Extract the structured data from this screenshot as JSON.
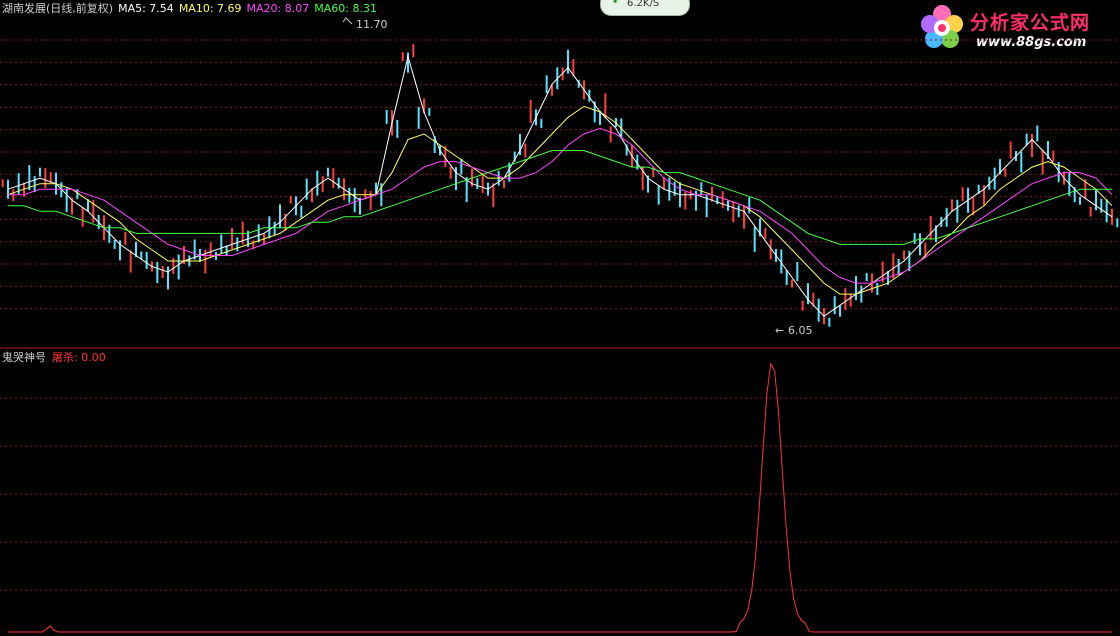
{
  "header": {
    "stock_title": "湖南发展(日线,前复权)",
    "ma_labels": [
      {
        "text": "MA5: 7.54",
        "color": "#ffffff"
      },
      {
        "text": "MA10: 7.69",
        "color": "#ffff66"
      },
      {
        "text": "MA20: 8.07",
        "color": "#ff44ff"
      },
      {
        "text": "MA60: 8.31",
        "color": "#44ff44"
      }
    ]
  },
  "speed_badge": {
    "text": "6.2K/S",
    "icon": "download-arrow-icon"
  },
  "logo": {
    "name": "分析家公式网",
    "url": "www.88gs.com",
    "icon": "flower-logo-icon"
  },
  "price_chart": {
    "high_label": "11.70",
    "low_label": "6.05"
  },
  "indicator": {
    "name": "鬼哭神号",
    "value_label": "屠杀: 0.00",
    "value_color": "#ff3333"
  },
  "chart_data": [
    {
      "type": "line",
      "title": "湖南发展(日线,前复权)",
      "yrange": [
        6.05,
        11.7
      ],
      "series": [
        {
          "name": "MA5",
          "color": "#ffffff",
          "values": [
            8.6,
            8.7,
            8.8,
            8.7,
            8.4,
            8.2,
            7.9,
            7.6,
            7.4,
            7.2,
            7.1,
            7.3,
            7.4,
            7.5,
            7.6,
            7.7,
            7.8,
            8.0,
            8.3,
            8.6,
            8.8,
            8.6,
            8.4,
            8.5,
            9.8,
            11.0,
            10.0,
            9.3,
            8.9,
            8.7,
            8.6,
            8.8,
            9.3,
            9.9,
            10.5,
            10.8,
            10.4,
            10.0,
            9.7,
            9.2,
            8.8,
            8.6,
            8.5,
            8.5,
            8.4,
            8.3,
            8.2,
            7.8,
            7.4,
            7.0,
            6.6,
            6.3,
            6.5,
            6.7,
            6.9,
            7.1,
            7.3,
            7.6,
            7.9,
            8.2,
            8.4,
            8.6,
            8.9,
            9.2,
            9.5,
            9.2,
            8.8,
            8.5,
            8.3,
            8.1
          ]
        },
        {
          "name": "MA10",
          "color": "#ffff66",
          "values": [
            8.5,
            8.6,
            8.7,
            8.7,
            8.6,
            8.4,
            8.2,
            8.0,
            7.7,
            7.5,
            7.3,
            7.3,
            7.3,
            7.4,
            7.5,
            7.6,
            7.7,
            7.8,
            8.0,
            8.2,
            8.4,
            8.5,
            8.5,
            8.5,
            8.9,
            9.5,
            9.6,
            9.4,
            9.2,
            9.0,
            8.8,
            8.8,
            9.0,
            9.3,
            9.6,
            9.9,
            10.1,
            10.0,
            9.8,
            9.5,
            9.2,
            8.9,
            8.7,
            8.6,
            8.5,
            8.4,
            8.3,
            8.1,
            7.8,
            7.5,
            7.2,
            6.9,
            6.7,
            6.7,
            6.8,
            6.9,
            7.1,
            7.3,
            7.6,
            7.8,
            8.1,
            8.3,
            8.6,
            8.8,
            9.0,
            9.1,
            9.0,
            8.8,
            8.6,
            8.3
          ]
        },
        {
          "name": "MA20",
          "color": "#ff44ff",
          "values": [
            8.5,
            8.5,
            8.6,
            8.6,
            8.6,
            8.5,
            8.4,
            8.2,
            8.0,
            7.8,
            7.6,
            7.5,
            7.4,
            7.4,
            7.4,
            7.5,
            7.6,
            7.7,
            7.8,
            8.0,
            8.2,
            8.3,
            8.4,
            8.5,
            8.6,
            8.8,
            9.0,
            9.1,
            9.1,
            9.0,
            8.9,
            8.8,
            8.8,
            8.9,
            9.1,
            9.4,
            9.6,
            9.7,
            9.6,
            9.4,
            9.1,
            8.8,
            8.6,
            8.5,
            8.5,
            8.4,
            8.3,
            8.2,
            8.0,
            7.8,
            7.5,
            7.2,
            7.0,
            6.9,
            6.9,
            7.0,
            7.1,
            7.3,
            7.5,
            7.7,
            7.9,
            8.1,
            8.3,
            8.5,
            8.7,
            8.8,
            8.9,
            8.9,
            8.8,
            8.5
          ]
        },
        {
          "name": "MA60",
          "color": "#44ff44",
          "values": [
            8.3,
            8.3,
            8.2,
            8.2,
            8.1,
            8.0,
            7.9,
            7.9,
            7.8,
            7.8,
            7.8,
            7.8,
            7.8,
            7.8,
            7.8,
            7.8,
            7.9,
            7.9,
            7.9,
            8.0,
            8.0,
            8.1,
            8.1,
            8.2,
            8.3,
            8.4,
            8.5,
            8.6,
            8.7,
            8.8,
            8.9,
            9.0,
            9.1,
            9.2,
            9.3,
            9.3,
            9.3,
            9.2,
            9.1,
            9.0,
            9.0,
            8.9,
            8.9,
            8.8,
            8.7,
            8.6,
            8.5,
            8.4,
            8.2,
            8.0,
            7.8,
            7.7,
            7.6,
            7.6,
            7.6,
            7.6,
            7.6,
            7.7,
            7.7,
            7.8,
            7.9,
            8.0,
            8.1,
            8.2,
            8.3,
            8.4,
            8.5,
            8.6,
            8.6,
            8.6
          ]
        }
      ]
    },
    {
      "type": "line",
      "title": "鬼哭神号",
      "series": [
        {
          "name": "屠杀",
          "color": "#ff3333",
          "values": [
            0,
            0,
            0,
            0,
            0,
            0,
            0,
            0,
            0,
            0,
            0.5,
            1.0,
            0.3,
            0,
            0,
            0,
            0,
            0,
            0,
            0,
            0,
            0,
            0,
            0,
            0,
            0,
            0,
            0,
            0,
            0,
            0,
            0,
            0,
            0,
            0,
            0,
            0,
            0,
            0,
            0,
            0,
            0,
            0,
            0,
            0,
            0,
            0,
            0,
            0,
            0,
            0,
            0,
            0,
            0,
            0,
            0,
            0,
            0,
            0,
            0,
            0,
            0,
            0,
            0,
            0,
            0,
            0,
            0,
            0,
            0,
            0,
            0,
            0,
            0,
            0,
            0,
            0,
            0,
            0,
            0,
            0,
            0,
            0,
            0,
            0,
            0,
            0,
            0,
            0,
            0,
            0,
            0,
            0,
            0,
            0,
            0,
            0,
            0,
            0,
            0,
            0,
            0,
            0,
            0,
            0,
            0,
            0,
            0,
            0,
            0,
            0,
            0,
            0,
            0,
            0,
            0,
            0,
            0,
            0,
            0,
            0,
            0,
            0,
            0,
            0,
            0,
            0,
            0,
            0,
            0,
            0,
            0,
            0,
            0,
            0,
            0,
            0,
            0,
            0,
            0,
            0,
            0,
            0,
            0,
            0,
            0,
            0,
            0,
            0,
            0,
            0,
            0,
            0,
            0,
            0,
            0,
            0,
            0,
            0,
            0,
            0,
            0,
            0,
            0,
            0,
            0,
            0,
            0,
            0,
            0,
            0,
            0,
            0,
            0,
            0,
            0,
            0,
            0,
            0,
            0,
            0,
            0,
            0,
            0,
            0,
            0,
            0,
            0,
            0,
            0,
            0,
            0,
            0,
            0,
            0,
            0,
            0,
            0,
            0,
            0,
            0,
            0,
            0,
            0,
            0,
            0,
            0,
            0,
            0,
            0,
            0,
            0,
            0,
            0,
            0,
            0,
            0,
            0,
            0,
            0,
            0,
            0,
            0,
            0,
            0,
            0,
            0,
            0,
            0,
            0,
            0,
            0,
            0,
            0,
            0,
            0,
            0,
            0,
            0,
            0,
            0,
            0,
            0,
            0,
            0,
            0,
            0,
            0,
            0,
            0,
            0,
            0,
            0,
            0,
            0,
            0,
            0,
            0,
            0,
            0,
            0,
            0,
            0,
            0,
            0,
            0,
            0,
            0,
            0,
            0,
            0,
            0,
            0,
            0,
            0,
            0,
            0,
            0,
            0,
            0,
            0,
            0,
            0,
            0,
            0,
            0,
            0,
            0,
            0
          ]
        }
      ]
    }
  ]
}
